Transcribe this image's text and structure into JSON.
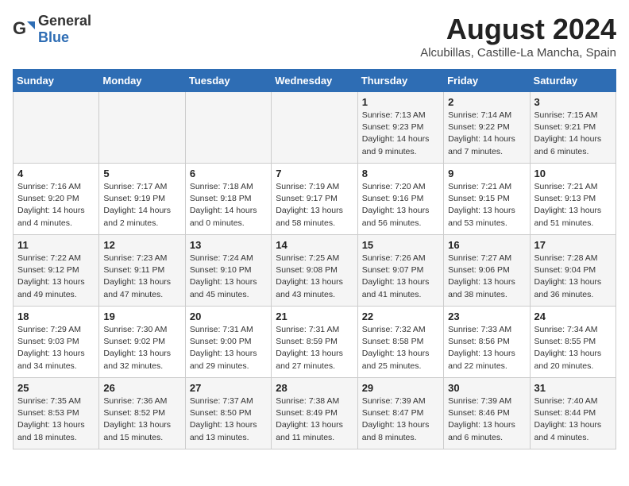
{
  "header": {
    "logo_general": "General",
    "logo_blue": "Blue",
    "month_year": "August 2024",
    "location": "Alcubillas, Castille-La Mancha, Spain"
  },
  "days_of_week": [
    "Sunday",
    "Monday",
    "Tuesday",
    "Wednesday",
    "Thursday",
    "Friday",
    "Saturday"
  ],
  "weeks": [
    [
      {
        "day": "",
        "info": ""
      },
      {
        "day": "",
        "info": ""
      },
      {
        "day": "",
        "info": ""
      },
      {
        "day": "",
        "info": ""
      },
      {
        "day": "1",
        "info": "Sunrise: 7:13 AM\nSunset: 9:23 PM\nDaylight: 14 hours\nand 9 minutes."
      },
      {
        "day": "2",
        "info": "Sunrise: 7:14 AM\nSunset: 9:22 PM\nDaylight: 14 hours\nand 7 minutes."
      },
      {
        "day": "3",
        "info": "Sunrise: 7:15 AM\nSunset: 9:21 PM\nDaylight: 14 hours\nand 6 minutes."
      }
    ],
    [
      {
        "day": "4",
        "info": "Sunrise: 7:16 AM\nSunset: 9:20 PM\nDaylight: 14 hours\nand 4 minutes."
      },
      {
        "day": "5",
        "info": "Sunrise: 7:17 AM\nSunset: 9:19 PM\nDaylight: 14 hours\nand 2 minutes."
      },
      {
        "day": "6",
        "info": "Sunrise: 7:18 AM\nSunset: 9:18 PM\nDaylight: 14 hours\nand 0 minutes."
      },
      {
        "day": "7",
        "info": "Sunrise: 7:19 AM\nSunset: 9:17 PM\nDaylight: 13 hours\nand 58 minutes."
      },
      {
        "day": "8",
        "info": "Sunrise: 7:20 AM\nSunset: 9:16 PM\nDaylight: 13 hours\nand 56 minutes."
      },
      {
        "day": "9",
        "info": "Sunrise: 7:21 AM\nSunset: 9:15 PM\nDaylight: 13 hours\nand 53 minutes."
      },
      {
        "day": "10",
        "info": "Sunrise: 7:21 AM\nSunset: 9:13 PM\nDaylight: 13 hours\nand 51 minutes."
      }
    ],
    [
      {
        "day": "11",
        "info": "Sunrise: 7:22 AM\nSunset: 9:12 PM\nDaylight: 13 hours\nand 49 minutes."
      },
      {
        "day": "12",
        "info": "Sunrise: 7:23 AM\nSunset: 9:11 PM\nDaylight: 13 hours\nand 47 minutes."
      },
      {
        "day": "13",
        "info": "Sunrise: 7:24 AM\nSunset: 9:10 PM\nDaylight: 13 hours\nand 45 minutes."
      },
      {
        "day": "14",
        "info": "Sunrise: 7:25 AM\nSunset: 9:08 PM\nDaylight: 13 hours\nand 43 minutes."
      },
      {
        "day": "15",
        "info": "Sunrise: 7:26 AM\nSunset: 9:07 PM\nDaylight: 13 hours\nand 41 minutes."
      },
      {
        "day": "16",
        "info": "Sunrise: 7:27 AM\nSunset: 9:06 PM\nDaylight: 13 hours\nand 38 minutes."
      },
      {
        "day": "17",
        "info": "Sunrise: 7:28 AM\nSunset: 9:04 PM\nDaylight: 13 hours\nand 36 minutes."
      }
    ],
    [
      {
        "day": "18",
        "info": "Sunrise: 7:29 AM\nSunset: 9:03 PM\nDaylight: 13 hours\nand 34 minutes."
      },
      {
        "day": "19",
        "info": "Sunrise: 7:30 AM\nSunset: 9:02 PM\nDaylight: 13 hours\nand 32 minutes."
      },
      {
        "day": "20",
        "info": "Sunrise: 7:31 AM\nSunset: 9:00 PM\nDaylight: 13 hours\nand 29 minutes."
      },
      {
        "day": "21",
        "info": "Sunrise: 7:31 AM\nSunset: 8:59 PM\nDaylight: 13 hours\nand 27 minutes."
      },
      {
        "day": "22",
        "info": "Sunrise: 7:32 AM\nSunset: 8:58 PM\nDaylight: 13 hours\nand 25 minutes."
      },
      {
        "day": "23",
        "info": "Sunrise: 7:33 AM\nSunset: 8:56 PM\nDaylight: 13 hours\nand 22 minutes."
      },
      {
        "day": "24",
        "info": "Sunrise: 7:34 AM\nSunset: 8:55 PM\nDaylight: 13 hours\nand 20 minutes."
      }
    ],
    [
      {
        "day": "25",
        "info": "Sunrise: 7:35 AM\nSunset: 8:53 PM\nDaylight: 13 hours\nand 18 minutes."
      },
      {
        "day": "26",
        "info": "Sunrise: 7:36 AM\nSunset: 8:52 PM\nDaylight: 13 hours\nand 15 minutes."
      },
      {
        "day": "27",
        "info": "Sunrise: 7:37 AM\nSunset: 8:50 PM\nDaylight: 13 hours\nand 13 minutes."
      },
      {
        "day": "28",
        "info": "Sunrise: 7:38 AM\nSunset: 8:49 PM\nDaylight: 13 hours\nand 11 minutes."
      },
      {
        "day": "29",
        "info": "Sunrise: 7:39 AM\nSunset: 8:47 PM\nDaylight: 13 hours\nand 8 minutes."
      },
      {
        "day": "30",
        "info": "Sunrise: 7:39 AM\nSunset: 8:46 PM\nDaylight: 13 hours\nand 6 minutes."
      },
      {
        "day": "31",
        "info": "Sunrise: 7:40 AM\nSunset: 8:44 PM\nDaylight: 13 hours\nand 4 minutes."
      }
    ]
  ]
}
